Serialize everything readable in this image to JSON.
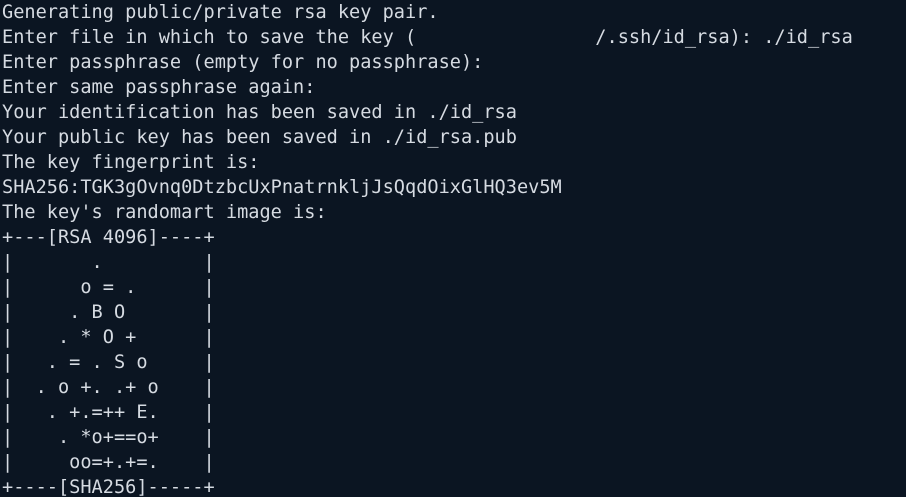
{
  "terminal": {
    "lines": [
      "Generating public/private rsa key pair.",
      "Enter file in which to save the key (                /.ssh/id_rsa): ./id_rsa",
      "Enter passphrase (empty for no passphrase):",
      "Enter same passphrase again:",
      "Your identification has been saved in ./id_rsa",
      "Your public key has been saved in ./id_rsa.pub",
      "The key fingerprint is:",
      "SHA256:TGK3gOvnq0DtzbcUxPnatrnkljJsQqdOixGlHQ3ev5M",
      "The key's randomart image is:",
      "+---[RSA 4096]----+",
      "|       .         |",
      "|      o = .      |",
      "|     . B O       |",
      "|    . * O +      |",
      "|   . = . S o     |",
      "|  . o +. .+ o    |",
      "|   . +.=++ E.    |",
      "|    . *o+==o+    |",
      "|     oo=+.+=.    |",
      "+----[SHA256]-----+"
    ]
  },
  "colors": {
    "background": "#0b1522",
    "foreground": "#d6dbe2"
  }
}
